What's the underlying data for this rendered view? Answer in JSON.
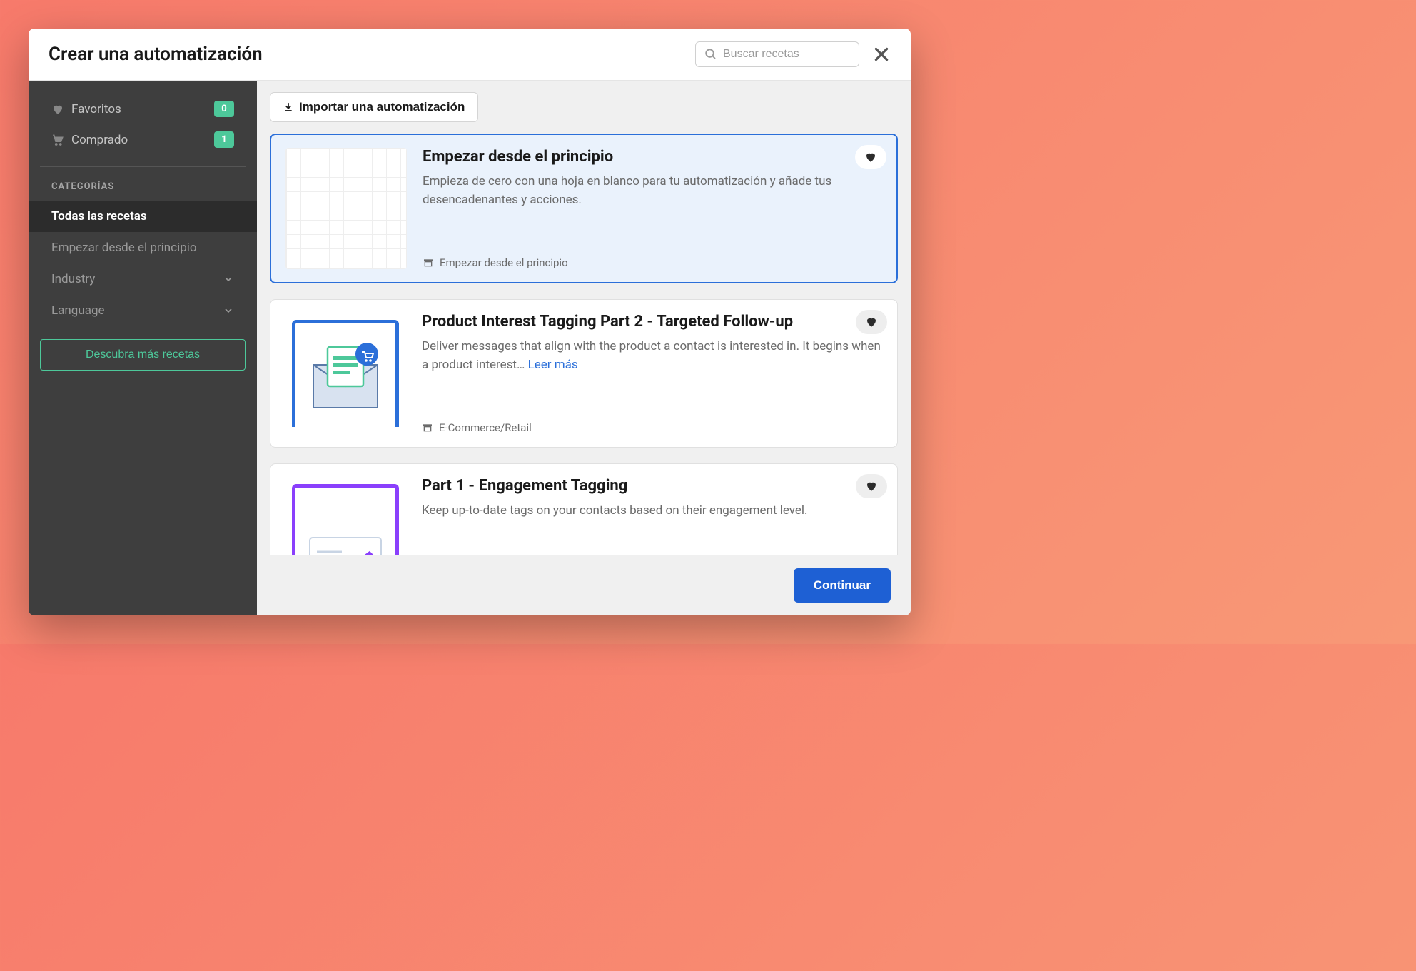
{
  "header": {
    "title": "Crear una automatización",
    "search_placeholder": "Buscar recetas"
  },
  "sidebar": {
    "favorites_label": "Favoritos",
    "favorites_count": "0",
    "purchased_label": "Comprado",
    "purchased_count": "1",
    "categories_heading": "CATEGORÍAS",
    "categories": [
      {
        "label": "Todas las recetas",
        "active": true,
        "expandable": false
      },
      {
        "label": "Empezar desde el principio",
        "active": false,
        "expandable": false
      },
      {
        "label": "Industry",
        "active": false,
        "expandable": true
      },
      {
        "label": "Language",
        "active": false,
        "expandable": true
      }
    ],
    "discover_label": "Descubra más recetas"
  },
  "toolbar": {
    "import_label": "Importar una automatización"
  },
  "recipes": [
    {
      "title": "Empezar desde el principio",
      "description": "Empieza de cero con una hoja en blanco para tu automatización y añade tus desencadenantes y acciones.",
      "category": "Empezar desde el principio",
      "selected": true,
      "thumb": "grid",
      "read_more": false
    },
    {
      "title": "Product Interest Tagging Part 2 - Targeted Follow-up",
      "description": "Deliver messages that align with the product a contact is interested in. It begins when a product interest… ",
      "category": "E-Commerce/Retail",
      "selected": false,
      "thumb": "email",
      "read_more": true
    },
    {
      "title": "Part 1 - Engagement Tagging",
      "description": "Keep up-to-date tags on your contacts based on their engagement level.",
      "category": "",
      "selected": false,
      "thumb": "engagement",
      "read_more": false
    }
  ],
  "read_more_label": "Leer más",
  "footer": {
    "continue_label": "Continuar"
  }
}
